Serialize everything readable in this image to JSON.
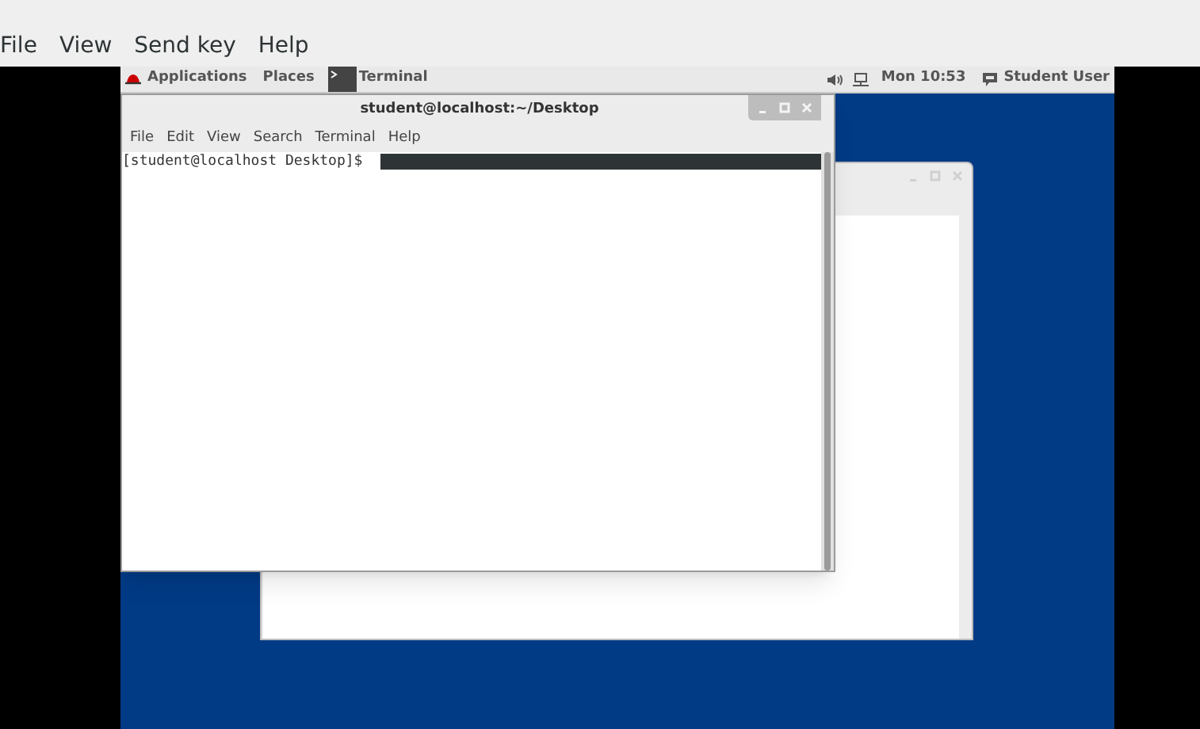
{
  "menu": [
    {
      "label": "File"
    },
    {
      "label": "View"
    },
    {
      "label": "Send key"
    },
    {
      "label": "Help"
    }
  ],
  "panel": {
    "applications": "Applications",
    "places": "Places",
    "task": "Terminal",
    "clock": "Mon 10:53",
    "user": "Student User"
  },
  "terminal": {
    "title": "student@localhost:~/Desktop",
    "menu": [
      {
        "label": "File"
      },
      {
        "label": "Edit"
      },
      {
        "label": "View"
      },
      {
        "label": "Search"
      },
      {
        "label": "Terminal"
      },
      {
        "label": "Help"
      }
    ],
    "prompt": "[student@localhost Desktop]$"
  }
}
